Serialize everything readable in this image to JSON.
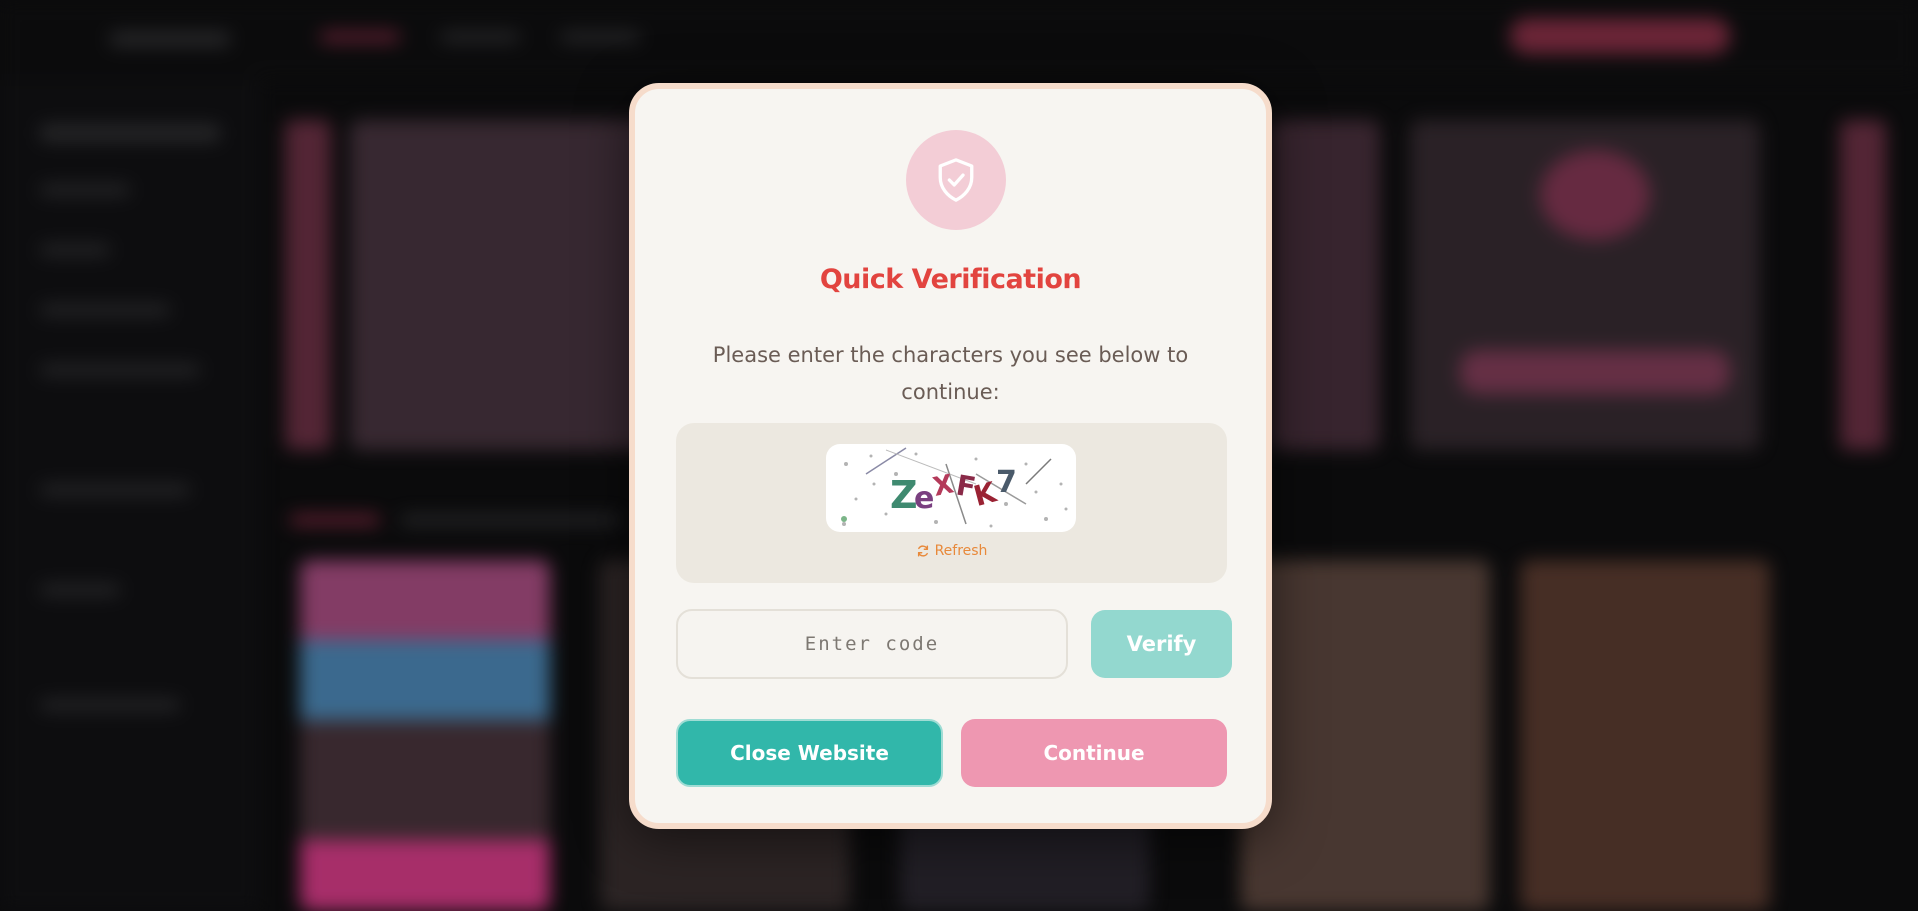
{
  "modal": {
    "title": "Quick Verification",
    "description": "Please enter the characters you see below to continue:",
    "captcha": {
      "text": "ZeXFK7",
      "refresh_label": "Refresh"
    },
    "code_input": {
      "placeholder": "Enter code",
      "value": ""
    },
    "verify_label": "Verify",
    "close_label": "Close Website",
    "continue_label": "Continue"
  },
  "colors": {
    "title": "#e2443f",
    "verify": "#93d8cf",
    "close": "#31b7aa",
    "continue": "#ee97b1",
    "refresh": "#e8893a",
    "shield_circle": "#f3cdd6"
  },
  "icons": {
    "shield": "shield-check-icon",
    "refresh": "refresh-icon"
  }
}
